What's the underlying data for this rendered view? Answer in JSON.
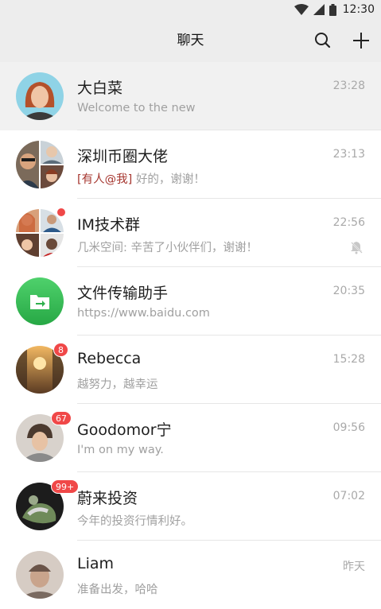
{
  "status_bar": {
    "time": "12:30"
  },
  "header": {
    "title": "聊天"
  },
  "colors": {
    "badge": "#f04848",
    "mention": "#a6362f",
    "file_helper": "#3cc05a"
  },
  "chats": [
    {
      "name": "大白菜",
      "message": "Welcome to the new",
      "time": "23:28",
      "avatar": "person-avatar"
    },
    {
      "name": "深圳币圈大佬",
      "mention": "[有人@我]",
      "message": "好的，谢谢！",
      "time": "23:13",
      "avatar": "group-avatar"
    },
    {
      "name": "IM技术群",
      "message": "几米空间: 辛苦了小伙伴们，谢谢！",
      "time": "22:56",
      "avatar": "group-avatar",
      "muted": true,
      "unread_dot": true
    },
    {
      "name": "文件传输助手",
      "message": "https://www.baidu.com",
      "time": "20:35",
      "avatar": "file-transfer-icon"
    },
    {
      "name": "Rebecca",
      "message": "越努力，越幸运",
      "time": "15:28",
      "badge": "8",
      "avatar": "photo-avatar"
    },
    {
      "name": "Goodomor宁",
      "message": "I'm on my way.",
      "time": "09:56",
      "badge": "67",
      "avatar": "person-avatar"
    },
    {
      "name": "蔚来投资",
      "message": "今年的投资行情利好。",
      "time": "07:02",
      "badge": "99+",
      "avatar": "photo-avatar"
    },
    {
      "name": "Liam",
      "message": "准备出发，哈哈",
      "time": "昨天",
      "avatar": "person-avatar"
    }
  ]
}
